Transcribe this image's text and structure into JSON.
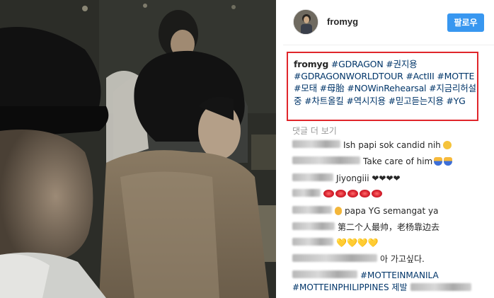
{
  "post": {
    "username": "fromyg",
    "follow_label": "팔로우"
  },
  "caption": {
    "user": "fromyg",
    "text": " #GDRAGON #권지용 #GDRAGONWORLDTOUR #ActIII #MOTTE #모태 #母胎 #NOWinRehearsal #지금리허설중 #차트올킬 #역시지용 #믿고듣는지용 #YG"
  },
  "more_comments": "댓글 더 보기",
  "comments": [
    {
      "user": "sabana_iina",
      "text": "Ish papi sok candid nih"
    },
    {
      "user": "carlarriola5449",
      "text": "Take care of him"
    },
    {
      "user": "ajinbaeil",
      "text": "Jiyongiii ❤❤❤❤"
    },
    {
      "user": "imimpi",
      "text": ""
    },
    {
      "user": "gohkenbh",
      "text": "papa YG semangat ya"
    },
    {
      "user": "lucky0429",
      "text": "第二个人最帅，老杨靠边去"
    },
    {
      "user": "fan_lineum",
      "text": "💛💛💛💛"
    },
    {
      "user": "mightyfinestbox",
      "text": "아 가고싶다."
    },
    {
      "user": "banyangmayabox",
      "text": "#MOTTEINMANILA"
    },
    {
      "user": "",
      "text": "#MOTTEINPHILIPPINES 제발"
    }
  ],
  "icons": [
    "lips-emoji",
    "heart-emoji",
    "yellow-heart-emoji",
    "ok-hand-emoji",
    "bow-emoji",
    "grin-emoji"
  ]
}
